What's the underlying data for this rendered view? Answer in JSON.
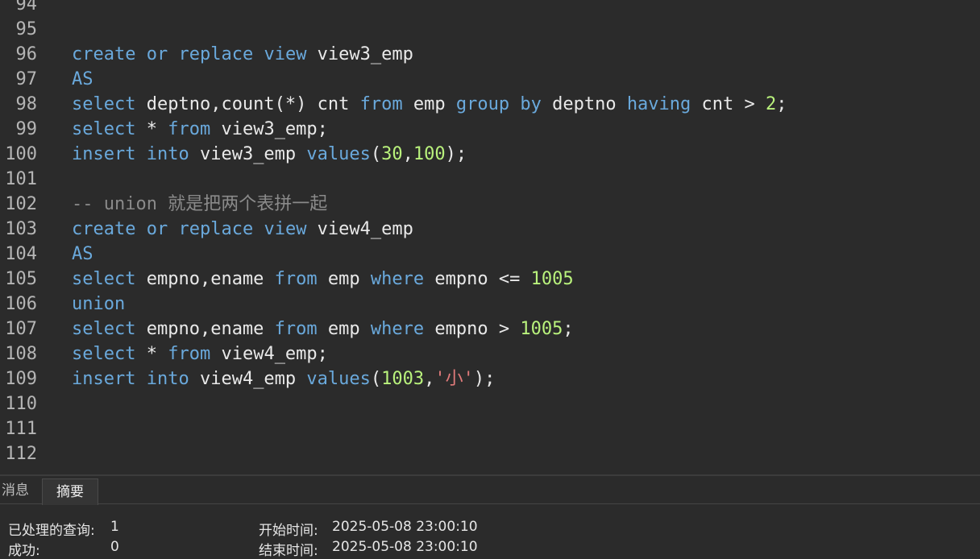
{
  "editor": {
    "line_numbers": [
      "94",
      "95",
      "96",
      "97",
      "98",
      "99",
      "100",
      "101",
      "102",
      "103",
      "104",
      "105",
      "106",
      "107",
      "108",
      "109",
      "110",
      "111",
      "112"
    ],
    "lines": [
      [],
      [],
      [
        {
          "t": "create",
          "c": "kw"
        },
        {
          "t": " "
        },
        {
          "t": "or",
          "c": "kw"
        },
        {
          "t": " "
        },
        {
          "t": "replace",
          "c": "kw"
        },
        {
          "t": " "
        },
        {
          "t": "view",
          "c": "kw"
        },
        {
          "t": " view3_emp",
          "c": "id"
        }
      ],
      [
        {
          "t": "AS",
          "c": "kw"
        }
      ],
      [
        {
          "t": "select",
          "c": "kw"
        },
        {
          "t": " deptno,count(*) cnt ",
          "c": "id"
        },
        {
          "t": "from",
          "c": "kw"
        },
        {
          "t": " emp ",
          "c": "id"
        },
        {
          "t": "group",
          "c": "kw"
        },
        {
          "t": " "
        },
        {
          "t": "by",
          "c": "kw"
        },
        {
          "t": " deptno ",
          "c": "id"
        },
        {
          "t": "having",
          "c": "kw"
        },
        {
          "t": " cnt > ",
          "c": "id"
        },
        {
          "t": "2",
          "c": "num"
        },
        {
          "t": ";",
          "c": "id"
        }
      ],
      [
        {
          "t": "select",
          "c": "kw"
        },
        {
          "t": " * ",
          "c": "id"
        },
        {
          "t": "from",
          "c": "kw"
        },
        {
          "t": " view3_emp;",
          "c": "id"
        }
      ],
      [
        {
          "t": "insert",
          "c": "kw"
        },
        {
          "t": " "
        },
        {
          "t": "into",
          "c": "kw"
        },
        {
          "t": " view3_emp ",
          "c": "id"
        },
        {
          "t": "values",
          "c": "kw"
        },
        {
          "t": "(",
          "c": "id"
        },
        {
          "t": "30",
          "c": "num"
        },
        {
          "t": ",",
          "c": "id"
        },
        {
          "t": "100",
          "c": "num"
        },
        {
          "t": ");",
          "c": "id"
        }
      ],
      [],
      [
        {
          "t": "-- union 就是把两个表拼一起",
          "c": "cm"
        }
      ],
      [
        {
          "t": "create",
          "c": "kw"
        },
        {
          "t": " "
        },
        {
          "t": "or",
          "c": "kw"
        },
        {
          "t": " "
        },
        {
          "t": "replace",
          "c": "kw"
        },
        {
          "t": " "
        },
        {
          "t": "view",
          "c": "kw"
        },
        {
          "t": " view4_emp",
          "c": "id"
        }
      ],
      [
        {
          "t": "AS",
          "c": "kw"
        }
      ],
      [
        {
          "t": "select",
          "c": "kw"
        },
        {
          "t": " empno,ename ",
          "c": "id"
        },
        {
          "t": "from",
          "c": "kw"
        },
        {
          "t": " emp ",
          "c": "id"
        },
        {
          "t": "where",
          "c": "kw"
        },
        {
          "t": " empno <= ",
          "c": "id"
        },
        {
          "t": "1005",
          "c": "num"
        }
      ],
      [
        {
          "t": "union",
          "c": "kw"
        }
      ],
      [
        {
          "t": "select",
          "c": "kw"
        },
        {
          "t": " empno,ename ",
          "c": "id"
        },
        {
          "t": "from",
          "c": "kw"
        },
        {
          "t": " emp ",
          "c": "id"
        },
        {
          "t": "where",
          "c": "kw"
        },
        {
          "t": " empno > ",
          "c": "id"
        },
        {
          "t": "1005",
          "c": "num"
        },
        {
          "t": ";",
          "c": "id"
        }
      ],
      [
        {
          "t": "select",
          "c": "kw"
        },
        {
          "t": " * ",
          "c": "id"
        },
        {
          "t": "from",
          "c": "kw"
        },
        {
          "t": " view4_emp;",
          "c": "id"
        }
      ],
      [
        {
          "t": "insert",
          "c": "kw"
        },
        {
          "t": " "
        },
        {
          "t": "into",
          "c": "kw"
        },
        {
          "t": " view4_emp ",
          "c": "id"
        },
        {
          "t": "values",
          "c": "kw"
        },
        {
          "t": "(",
          "c": "id"
        },
        {
          "t": "1003",
          "c": "num"
        },
        {
          "t": ",",
          "c": "id"
        },
        {
          "t": "'小'",
          "c": "str"
        },
        {
          "t": ");",
          "c": "id"
        }
      ],
      [],
      [],
      []
    ]
  },
  "panel": {
    "tabs": [
      "消息",
      "摘要"
    ],
    "active_tab": "摘要",
    "queries_label": "已处理的查询:",
    "queries_value": "1",
    "success_label": "成功:",
    "success_value": "0",
    "start_label": "开始时间:",
    "start_value": "2025-05-08 23:00:10",
    "end_label": "结束时间:",
    "end_value": "2025-05-08 23:00:10"
  },
  "colors": {
    "keyword": "#6aa9dc",
    "identifier": "#e9e9e9",
    "number": "#b9f27c",
    "string": "#e07a7a",
    "comment": "#8a8a8a",
    "background": "#2b2b2b"
  }
}
